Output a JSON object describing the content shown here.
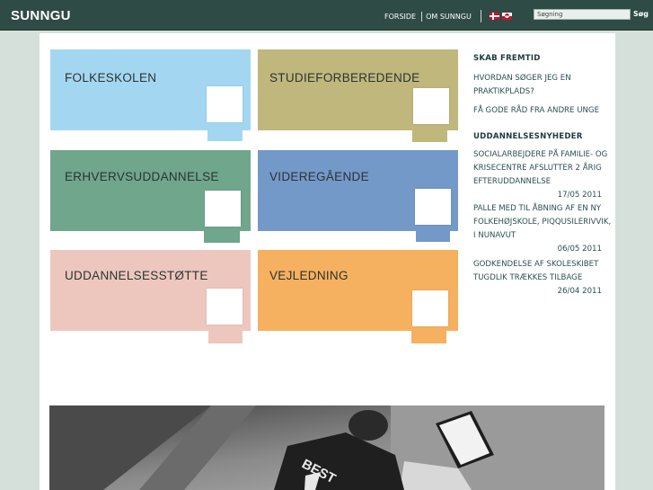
{
  "header": {
    "logo": "SUNNGU",
    "nav": [
      "FORSIDE",
      "OM SUNNGU"
    ],
    "search_placeholder": "Søgning",
    "search_button": "Søg",
    "flags": [
      "danish-flag-icon",
      "greenlandic-flag-icon"
    ]
  },
  "tiles": [
    {
      "label": "FOLKESKOLEN",
      "color": "#a3d7f1"
    },
    {
      "label": "STUDIEFORBEREDENDE",
      "color": "#bfb77c"
    },
    {
      "label": "ERHVERVSUDDANNELSE",
      "color": "#6fa68c"
    },
    {
      "label": "VIDEREGÅENDE",
      "color": "#7399c9"
    },
    {
      "label": "UDDANNELSESSTØTTE",
      "color": "#edc7be"
    },
    {
      "label": "VEJLEDNING",
      "color": "#f6b160"
    }
  ],
  "sidebar": {
    "section1": {
      "title": "SKAB FREMTID",
      "links": [
        "HVORDAN SØGER JEG EN PRAKTIKPLADS?",
        "FÅ GODE RÅD FRA ANDRE UNGE"
      ]
    },
    "section2": {
      "title": "UDDANNELSESNYHEDER",
      "news": [
        {
          "text": "SOCIALARBEJDERE PÅ FAMILIE- OG KRISECENTRE AFSLUTTER 2 ÅRIG EFTERUDDANNELSE",
          "date": "17/05 2011"
        },
        {
          "text": "PALLE MED TIL ÅBNING AF EN NY FOLKEHØJSKOLE, PIQQUSILERIVVIK, I NUNAVUT",
          "date": "06/05 2011"
        },
        {
          "text": "GODKENDELSE AF SKOLESKIBET TUGDLIK TRÆKKES TILBAGE",
          "date": "26/04 2011"
        }
      ]
    }
  },
  "photo": {
    "shirt_text": "BEST"
  }
}
